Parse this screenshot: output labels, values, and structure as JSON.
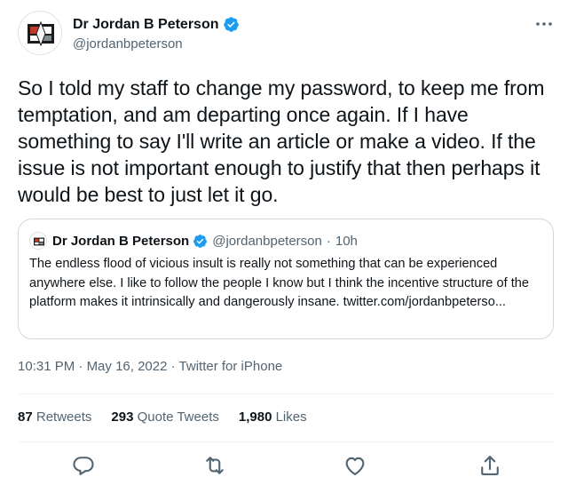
{
  "author": {
    "name": "Dr Jordan B Peterson",
    "handle": "@jordanbpeterson",
    "verified": true
  },
  "tweet": {
    "text": "So I told my staff to change my password, to keep me from temptation, and am departing once again. If I have something to say I'll write an article or make a video. If the issue is not important enough to justify that then perhaps it would be best to just let it go."
  },
  "quoted_tweet": {
    "name": "Dr Jordan B Peterson",
    "handle": "@jordanbpeterson",
    "time": "10h",
    "separator": "·",
    "text": "The endless flood of vicious insult is really not something that can be experienced anywhere else. I like to follow the people I know but I think the incentive structure of the platform makes it intrinsically and dangerously insane. twitter.com/jordanbpeterso..."
  },
  "meta": {
    "time": "10:31 PM",
    "date": "May 16, 2022",
    "source": "Twitter for iPhone",
    "separator": "·"
  },
  "stats": {
    "retweets_count": "87",
    "retweets_label": "Retweets",
    "quote_count": "293",
    "quote_label": "Quote Tweets",
    "likes_count": "1,980",
    "likes_label": "Likes"
  },
  "colors": {
    "verified_blue": "#1d9bf0",
    "secondary_text": "#536471",
    "border": "#cfd9de"
  },
  "icons": [
    "more-icon",
    "verified-icon",
    "reply-icon",
    "retweet-icon",
    "like-icon",
    "share-icon"
  ]
}
